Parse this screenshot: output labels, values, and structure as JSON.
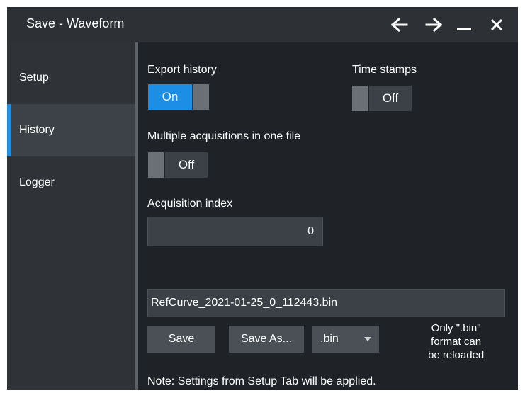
{
  "window": {
    "title": "Save - Waveform"
  },
  "titlebar_icons": [
    "back-arrow-icon",
    "forward-arrow-icon",
    "minimize-icon",
    "close-icon"
  ],
  "sidebar": {
    "items": [
      {
        "label": "Setup"
      },
      {
        "label": "History"
      },
      {
        "label": "Logger"
      }
    ],
    "active": "History"
  },
  "history": {
    "export_history": {
      "label": "Export history",
      "value": "On"
    },
    "time_stamps": {
      "label": "Time stamps",
      "value": "Off"
    },
    "multiple_acq": {
      "label": "Multiple acquisitions in one file",
      "value": "Off"
    },
    "acq_index": {
      "label": "Acquisition index",
      "value": "0"
    },
    "filename": "RefCurve_2021-01-25_0_112443.bin",
    "save_label": "Save",
    "save_as_label": "Save As...",
    "format_value": ".bin",
    "format_note_1": "Only \".bin\"",
    "format_note_2": "format can",
    "format_note_3": "be reloaded",
    "note": "Note: Settings from Setup Tab will be applied."
  },
  "colors": {
    "accent": "#1d8ee6",
    "background": "#1f2226",
    "sidebar": "#2f3337"
  }
}
